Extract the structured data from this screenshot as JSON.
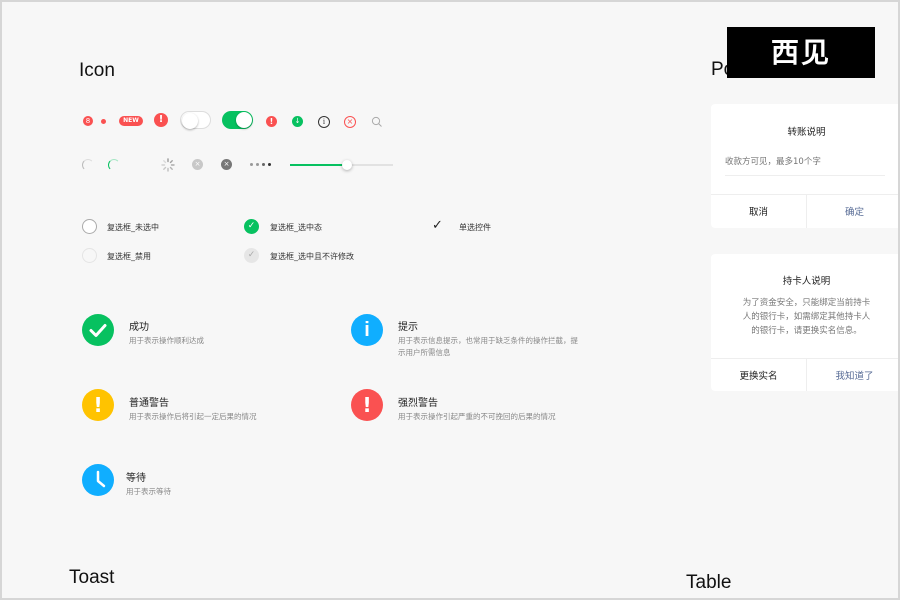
{
  "sections": {
    "icon_title": "Icon",
    "popup_title": "Po",
    "toast_title": "Toast",
    "table_title": "Table"
  },
  "logo_text": "西见",
  "badges": {
    "count": "8",
    "new_label": "NEW",
    "warn": "!"
  },
  "slider": {
    "value_percent": 55
  },
  "checkboxes": {
    "unchecked": "复选框_未选中",
    "checked": "复选框_选中态",
    "radio": "单选控件",
    "disabled": "复选框_禁用",
    "checked_disabled": "复选框_选中且不许修改"
  },
  "messages": [
    {
      "title": "成功",
      "desc": "用于表示操作顺利达成",
      "color": "#07c160"
    },
    {
      "title": "提示",
      "desc": "用于表示信息提示，也常用于缺乏条件的操作拦截，提示用户所需信息",
      "color": "#10aeff"
    },
    {
      "title": "普通警告",
      "desc": "用于表示操作后将引起一定后果的情况",
      "color": "#ffc300"
    },
    {
      "title": "强烈警告",
      "desc": "用于表示操作引起严重的不可挽回的后果的情况",
      "color": "#fa5151"
    },
    {
      "title": "等待",
      "desc": "用于表示等待",
      "color": "#10aeff"
    }
  ],
  "dialog1": {
    "title": "转账说明",
    "placeholder": "收款方可见，最多10个字",
    "cancel": "取消",
    "confirm": "确定"
  },
  "dialog2": {
    "title": "持卡人说明",
    "body_line1": "为了资金安全，只能绑定当前持卡",
    "body_line2": "人的银行卡，如需绑定其他持卡人",
    "body_line3": "的银行卡，请更换实名信息。",
    "left": "更换实名",
    "right": "我知道了"
  },
  "colors": {
    "green": "#07c160",
    "red": "#fa5151",
    "blue": "#10aeff",
    "yellow": "#ffc300",
    "link": "#576b95"
  }
}
